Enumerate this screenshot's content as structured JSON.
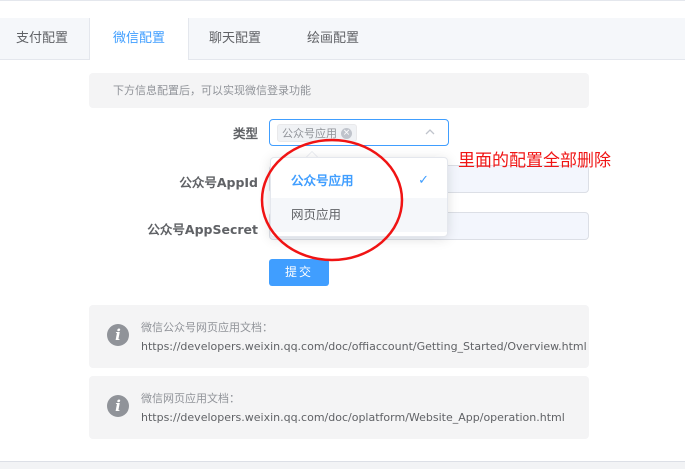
{
  "tabs": [
    {
      "label": "支付配置",
      "active": false
    },
    {
      "label": "微信配置",
      "active": true
    },
    {
      "label": "聊天配置",
      "active": false
    },
    {
      "label": "绘画配置",
      "active": false
    }
  ],
  "alert": {
    "text": "下方信息配置后，可以实现微信登录功能"
  },
  "form": {
    "type_label": "类型",
    "type_selected_tag": "公众号应用",
    "appid_label": "公众号AppId",
    "appid_value": "",
    "appsecret_label": "公众号AppSecret",
    "appsecret_value": "",
    "submit_label": "提交"
  },
  "dropdown": {
    "options": [
      {
        "label": "公众号应用",
        "selected": true
      },
      {
        "label": "网页应用",
        "selected": false
      }
    ]
  },
  "docs": [
    {
      "title": "微信公众号网页应用文档：",
      "url": "https://developers.weixin.qq.com/doc/offiaccount/Getting_Started/Overview.html"
    },
    {
      "title": "微信网页应用文档：",
      "url": "https://developers.weixin.qq.com/doc/oplatform/Website_App/operation.html"
    }
  ],
  "annotation": {
    "text": "里面的配置全部删除",
    "color": "#f01414"
  },
  "colors": {
    "accent": "#409eff",
    "annotation": "#f01414"
  },
  "icons": {
    "info": "info-circle-icon",
    "check": "check-icon",
    "arrow": "chevron-up-icon",
    "tag_close": "close-circle-icon"
  }
}
